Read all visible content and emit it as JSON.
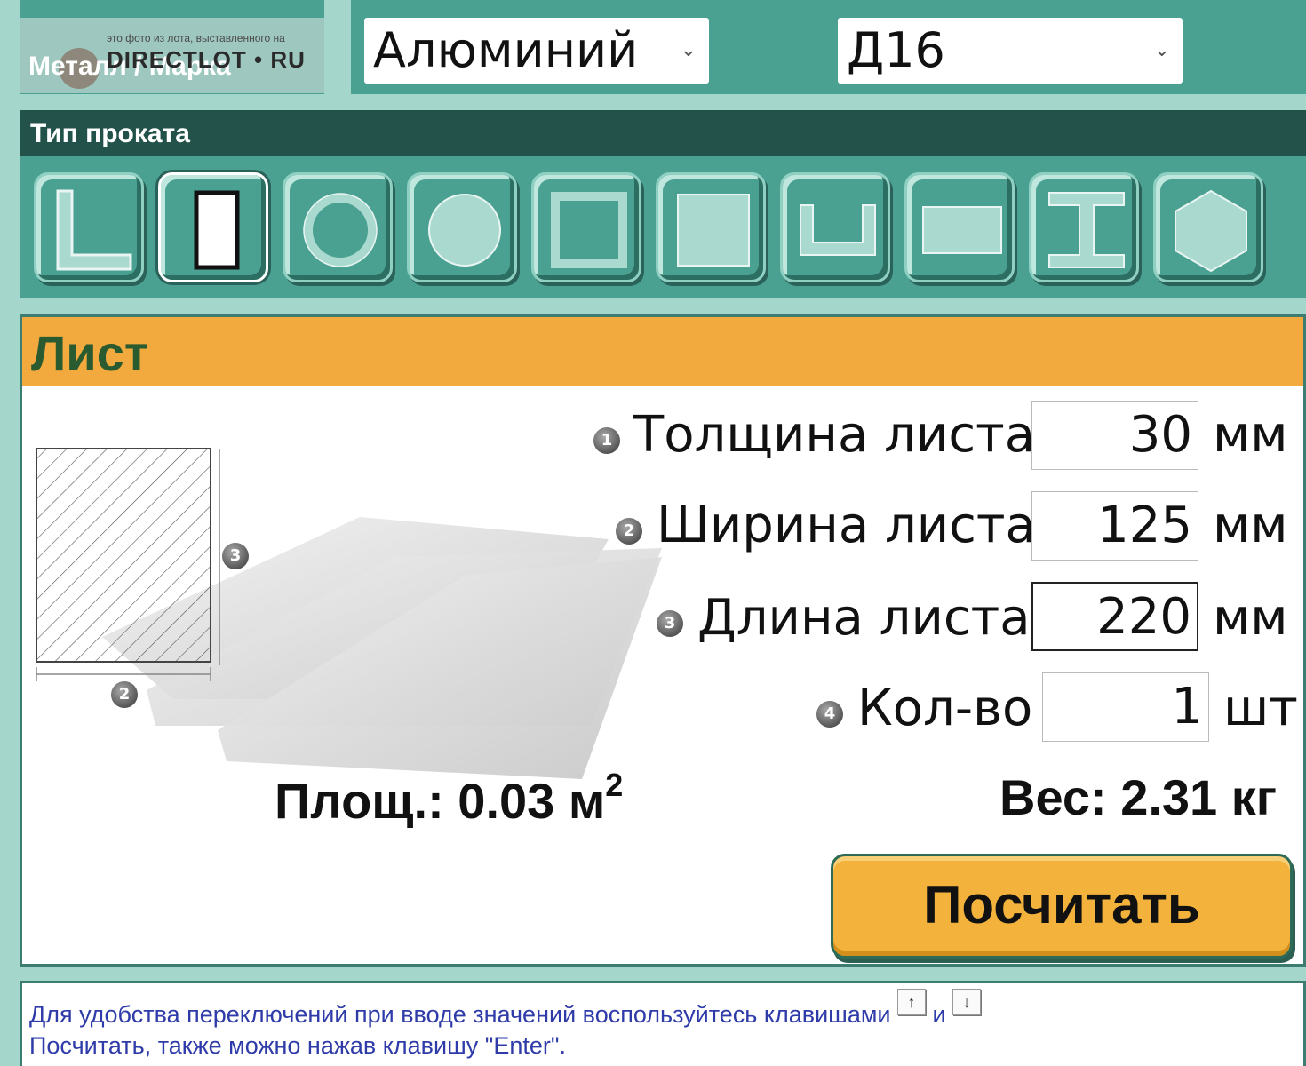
{
  "header": {
    "metal_label": "Металл / Марка",
    "watermark_small": "это фото из лота, выставленного на",
    "watermark_big": "DIRECTLOT • RU",
    "metal_select": "Алюминий",
    "grade_select": "Д16"
  },
  "rolling_type": {
    "title": "Тип проката",
    "shapes": [
      {
        "icon": "angle-icon",
        "active": false
      },
      {
        "icon": "sheet-icon",
        "active": true
      },
      {
        "icon": "pipe-icon",
        "active": false
      },
      {
        "icon": "round-bar-icon",
        "active": false
      },
      {
        "icon": "square-tube-icon",
        "active": false
      },
      {
        "icon": "square-bar-icon",
        "active": false
      },
      {
        "icon": "channel-icon",
        "active": false
      },
      {
        "icon": "strip-icon",
        "active": false
      },
      {
        "icon": "i-beam-icon",
        "active": false
      },
      {
        "icon": "hexagon-icon",
        "active": false
      }
    ]
  },
  "sheet": {
    "title": "Лист",
    "fields": [
      {
        "num": "1",
        "label": "Толщина листа",
        "value": "30",
        "unit": "мм"
      },
      {
        "num": "2",
        "label": "Ширина листа",
        "value": "125",
        "unit": "мм"
      },
      {
        "num": "3",
        "label": "Длина листа",
        "value": "220",
        "unit": "мм"
      },
      {
        "num": "4",
        "label": "Кол-во",
        "value": "1",
        "unit": "шт"
      }
    ],
    "diagram_labels": {
      "height": "3",
      "width": "2"
    },
    "area_label": "Площ.: 0.03 м",
    "area_sup": "2",
    "weight_label": "Вес: 2.31 кг",
    "calc_button": "Посчитать"
  },
  "hint": {
    "line1": "Для удобства переключений при вводе значений воспользуйтесь клавишами",
    "key_up": "↑",
    "and": "и",
    "key_down": "↓",
    "line2": "Посчитать, также можно нажав клавишу \"Enter\"."
  },
  "colors": {
    "teal": "#4aa192",
    "dark_teal": "#225249",
    "orange": "#f2aa3e",
    "button": "#f3b23b",
    "hint_text": "#2e3ba8"
  }
}
